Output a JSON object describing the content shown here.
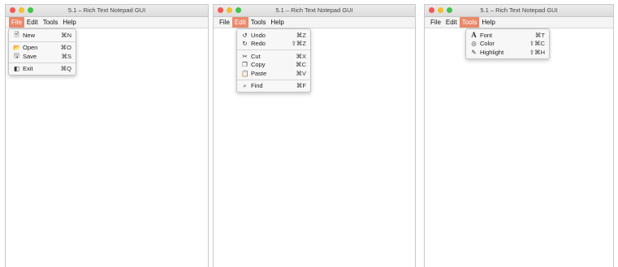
{
  "windows": [
    {
      "title": "5.1 – Rich Text Notepad GUI",
      "menus": [
        "File",
        "Edit",
        "Tools",
        "Help"
      ],
      "active_menu": "File",
      "dropdown": [
        {
          "label": "New",
          "shortcut": "⌘N",
          "icon": "new-document-icon",
          "glyph": "🗎"
        },
        {
          "separator": true
        },
        {
          "label": "Open",
          "shortcut": "⌘O",
          "icon": "folder-icon",
          "glyph": "📂"
        },
        {
          "label": "Save",
          "shortcut": "⌘S",
          "icon": "save-icon",
          "glyph": "🖫"
        },
        {
          "separator": true
        },
        {
          "label": "Exit",
          "shortcut": "⌘Q",
          "icon": "exit-icon",
          "glyph": "◧"
        }
      ]
    },
    {
      "title": "5.1 – Rich Text Notepad GUI",
      "menus": [
        "File",
        "Edit",
        "Tools",
        "Help"
      ],
      "active_menu": "Edit",
      "dropdown": [
        {
          "label": "Undo",
          "shortcut": "⌘Z",
          "icon": "undo-icon",
          "glyph": "↺"
        },
        {
          "label": "Redo",
          "shortcut": "⇧⌘Z",
          "icon": "redo-icon",
          "glyph": "↻"
        },
        {
          "separator": true
        },
        {
          "label": "Cut",
          "shortcut": "⌘X",
          "icon": "scissors-icon",
          "glyph": "✂"
        },
        {
          "label": "Copy",
          "shortcut": "⌘C",
          "icon": "copy-icon",
          "glyph": "❐"
        },
        {
          "label": "Paste",
          "shortcut": "⌘V",
          "icon": "paste-icon",
          "glyph": "📋"
        },
        {
          "separator": true
        },
        {
          "label": "Find",
          "shortcut": "⌘F",
          "icon": "search-icon",
          "glyph": "⌕"
        }
      ]
    },
    {
      "title": "5.1 – Rich Text Notepad GUI",
      "menus": [
        "File",
        "Edit",
        "Tools",
        "Help"
      ],
      "active_menu": "Tools",
      "dropdown": [
        {
          "label": "Font",
          "shortcut": "⌘T",
          "icon": "font-icon",
          "glyph": "A"
        },
        {
          "label": "Color",
          "shortcut": "⇧⌘C",
          "icon": "palette-icon",
          "glyph": "◎"
        },
        {
          "label": "Highlight",
          "shortcut": "⇧⌘H",
          "icon": "highlighter-icon",
          "glyph": "✎"
        }
      ]
    }
  ],
  "colors": {
    "accent": "#e9896b"
  }
}
